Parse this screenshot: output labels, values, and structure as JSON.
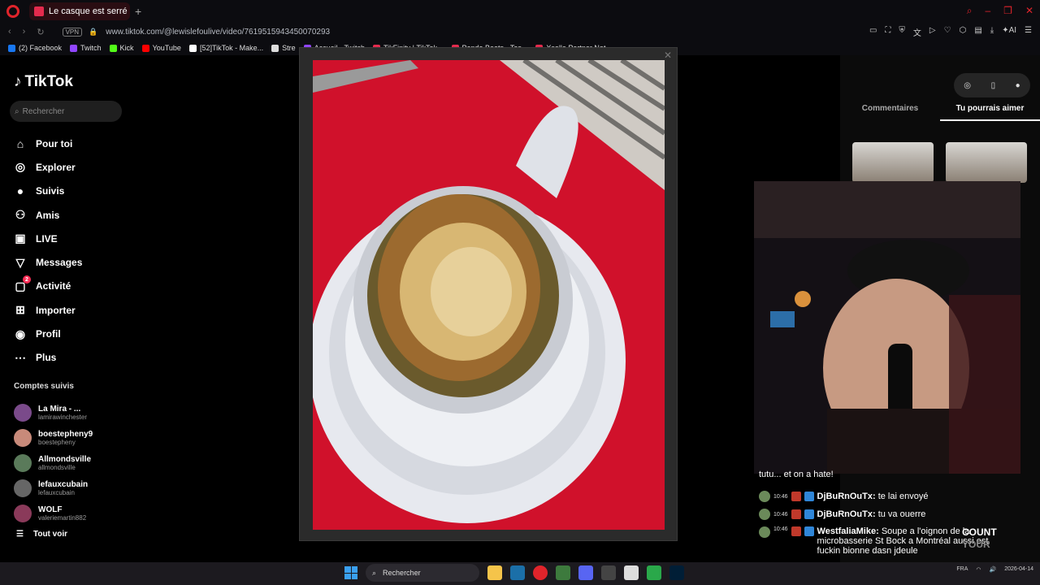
{
  "browser": {
    "tab_title": "Le casque est serré en ti",
    "url": "www.tiktok.com/@lewislefoulive/video/7619515943450070293",
    "vpn_label": "VPN",
    "bookmarks": [
      {
        "label": "(2) Facebook",
        "color": "#1877f2"
      },
      {
        "label": "Twitch",
        "color": "#9146ff"
      },
      {
        "label": "Kick",
        "color": "#53fc18"
      },
      {
        "label": "YouTube",
        "color": "#ff0000"
      },
      {
        "label": "[52]TikTok - Make...",
        "color": "#ffffff"
      },
      {
        "label": "Stre",
        "color": "#dddddd"
      },
      {
        "label": "Accueil - Twitch",
        "color": "#9146ff"
      },
      {
        "label": "TikFinity | TikTok...",
        "color": "#e32b4d"
      },
      {
        "label": "Panda Beats - Tes...",
        "color": "#e32b4d"
      },
      {
        "label": "Xsolla Partner Net...",
        "color": "#e32b4d"
      }
    ]
  },
  "tiktok": {
    "logo": "TikTok",
    "search_placeholder": "Rechercher",
    "nav": [
      {
        "label": "Pour toi",
        "icon": "home-icon"
      },
      {
        "label": "Explorer",
        "icon": "compass-icon"
      },
      {
        "label": "Suivis",
        "icon": "avatar-icon"
      },
      {
        "label": "Amis",
        "icon": "friends-icon"
      },
      {
        "label": "LIVE",
        "icon": "live-icon"
      },
      {
        "label": "Messages",
        "icon": "messages-icon"
      },
      {
        "label": "Activité",
        "icon": "activity-icon",
        "badge": "2"
      },
      {
        "label": "Importer",
        "icon": "upload-icon"
      },
      {
        "label": "Profil",
        "icon": "profile-icon"
      },
      {
        "label": "Plus",
        "icon": "more-icon"
      }
    ],
    "followed_title": "Comptes suivis",
    "followed": [
      {
        "name": "La Mira - ...",
        "handle": "lamirawinchester"
      },
      {
        "name": "boestepheny9",
        "handle": "boestepheny"
      },
      {
        "name": "Allmondsville",
        "handle": "allmondsville"
      },
      {
        "name": "lefauxcubain",
        "handle": "lefauxcubain"
      },
      {
        "name": "WOLF",
        "handle": "valeriemartin882"
      }
    ],
    "see_all": "Tout voir",
    "right_tabs": {
      "comments": "Commentaires",
      "suggested": "Tu pourrais aimer"
    }
  },
  "chat": {
    "lines": [
      {
        "time": "10:46",
        "user": "DjBuRnOuTx:",
        "msg": "te lai envoyé"
      },
      {
        "time": "10:46",
        "user": "DjBuRnOuTx:",
        "msg": "tu va ouerre"
      },
      {
        "time": "10:46",
        "user": "WestfaliaMike:",
        "msg": "Soupe a l'oignon de la microbasserie St Bock a Montréal aussi est fuckin bionne dasn jdeule"
      }
    ],
    "partial_top": "tutu... et on a hate!",
    "count_label": "COUNT",
    "count_sub": "YOUR"
  },
  "taskbar": {
    "search_label": "Rechercher",
    "lang": "FRA",
    "date": "2026-04-14"
  }
}
